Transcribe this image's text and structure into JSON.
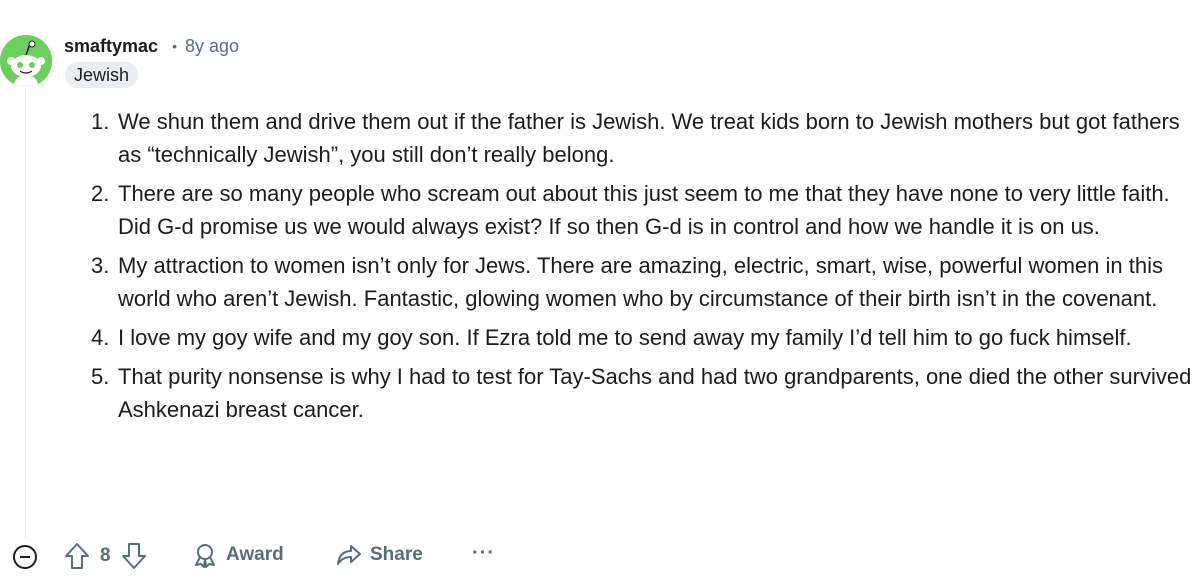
{
  "comment": {
    "username": "smaftymac",
    "separator": "•",
    "time": "8y ago",
    "flair": "Jewish",
    "points": [
      {
        "num": "1.",
        "text": "We shun them and drive them out if the father is Jewish. We treat kids born to Jewish mothers but got fathers as “technically Jewish”, you still don’t really belong."
      },
      {
        "num": "2.",
        "text": "There are so many people who scream out about this just seem to me that they have none to very little faith. Did G-d promise us we would always exist? If so then G-d is in control and how we handle it is on us."
      },
      {
        "num": "3.",
        "text": "My attraction to women isn’t only for Jews. There are amazing, electric, smart, wise, powerful women in this world who aren’t Jewish. Fantastic, glowing women who by circumstance of their birth isn’t in the covenant."
      },
      {
        "num": "4.",
        "text": "I love my goy wife and my goy son. If Ezra told me to send away my family I’d tell him to go fuck himself."
      },
      {
        "num": "5.",
        "text": "That purity nonsense is why I had to test for Tay-Sachs and had two grandparents, one died the other survived Ashkenazi breast cancer."
      }
    ]
  },
  "actions": {
    "vote_count": "8",
    "award_label": "Award",
    "share_label": "Share",
    "more_label": "···"
  },
  "colors": {
    "avatar_bg": "#6ad25a",
    "meta_text": "#576f76",
    "flair_bg": "#eaedef"
  },
  "icons": [
    "snoo-avatar-icon",
    "collapse-icon",
    "upvote-icon",
    "downvote-icon",
    "award-icon",
    "share-icon",
    "more-icon"
  ]
}
